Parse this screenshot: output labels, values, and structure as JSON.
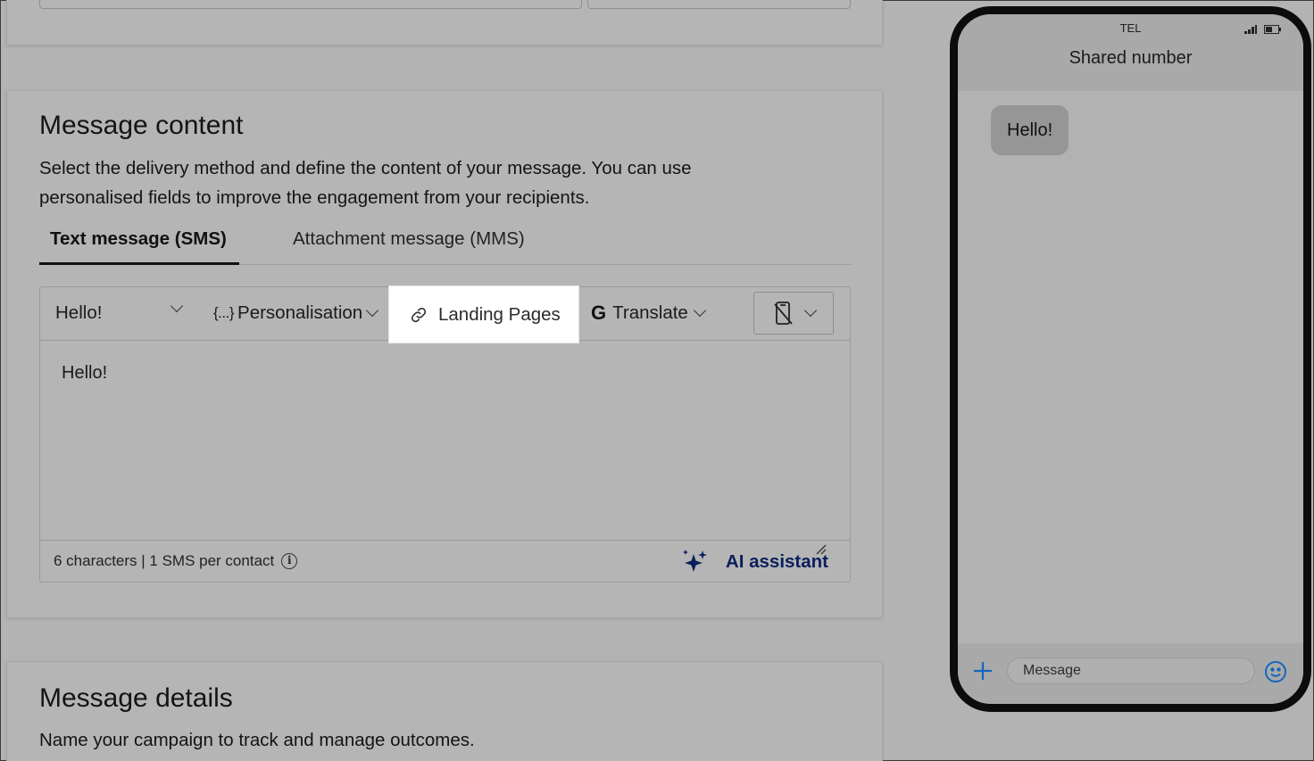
{
  "content_card": {
    "title": "Message content",
    "description": "Select the delivery method and define the content of your message. You can use personalised fields to improve the engagement from your recipients.",
    "tabs": [
      {
        "label": "Text message (SMS)",
        "active": true
      },
      {
        "label": "Attachment message (MMS)",
        "active": false
      }
    ],
    "toolbar": {
      "template_value": "Hello!",
      "personalisation_icon": "{...}",
      "personalisation_label": "Personalisation",
      "landing_pages_label": "Landing Pages",
      "translate_icon": "G",
      "translate_label": "Translate",
      "device_icon": "mobile-off-icon"
    },
    "message_text": "Hello!",
    "char_count": "6 characters | 1 SMS per contact",
    "ai_assistant_label": "AI assistant"
  },
  "details_card": {
    "title": "Message details",
    "description": "Name your campaign to track and manage outcomes."
  },
  "phone_preview": {
    "carrier": "TEL",
    "contact_name": "Shared number",
    "bubble_text": "Hello!",
    "input_placeholder": "Message"
  },
  "colors": {
    "accent_blue": "#1565c0",
    "ai_navy": "#0a1f5c"
  }
}
